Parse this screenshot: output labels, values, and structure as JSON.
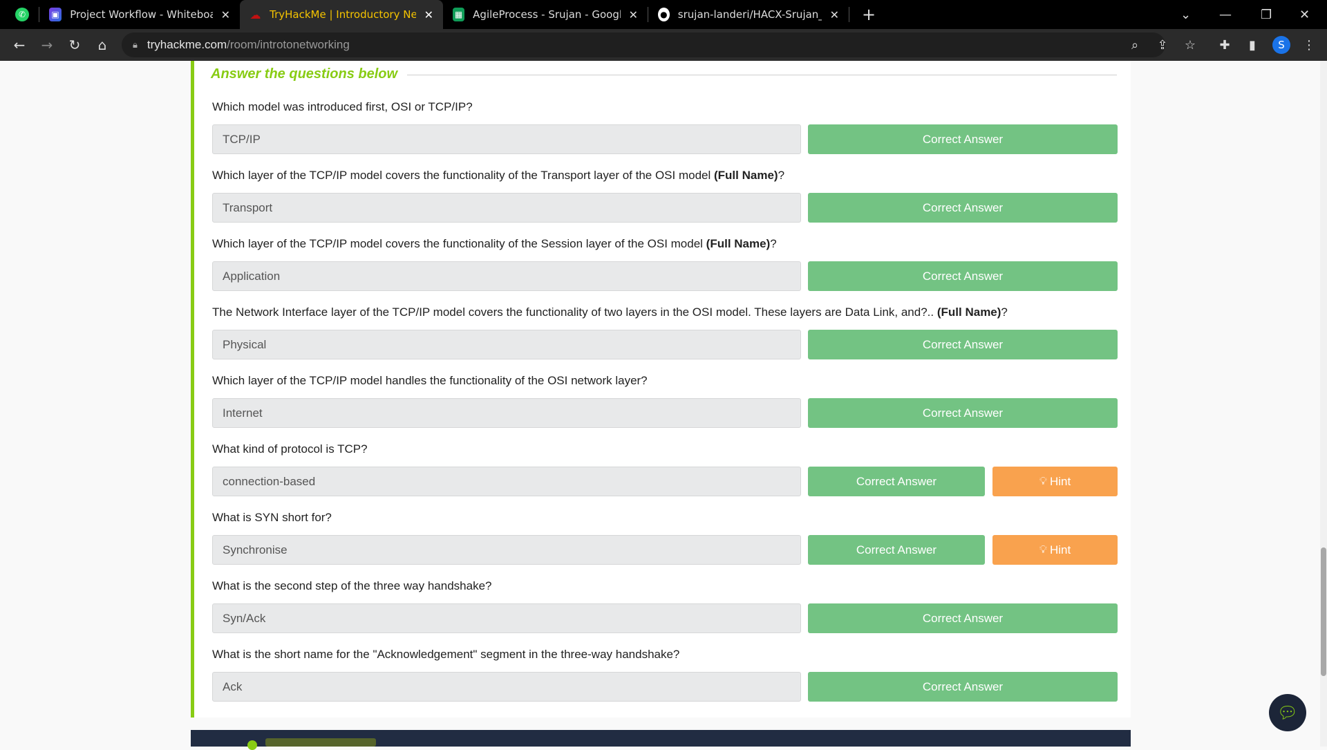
{
  "browser": {
    "tabs": [
      {
        "title": "",
        "icon": "whatsapp-icon",
        "color": "#25d366"
      },
      {
        "title": "Project Workflow - Whiteboard",
        "icon": "whiteboard-icon",
        "color": "#7b3fe4"
      },
      {
        "title": "TryHackMe | Introductory Networ",
        "icon": "tryhackme-icon",
        "color": "#c11111",
        "active": true
      },
      {
        "title": "AgileProcess - Srujan - Google Sh",
        "icon": "google-sheets-icon",
        "color": "#0f9d58"
      },
      {
        "title": "srujan-landeri/HACX-Srujan_Land",
        "icon": "github-icon",
        "color": "#ffffff"
      }
    ],
    "url_host": "tryhackme.com",
    "url_path": "/room/introtonetworking",
    "profile_initial": "S"
  },
  "section": {
    "heading": "Answer the questions below"
  },
  "questions": [
    {
      "text": "Which model was introduced first, OSI or TCP/IP?",
      "bold": "",
      "suffix": "",
      "answer": "TCP/IP",
      "button": "Correct Answer",
      "hint": ""
    },
    {
      "text": "Which layer of the TCP/IP model covers the functionality of the Transport layer of the OSI model ",
      "bold": "(Full Name)",
      "suffix": "?",
      "answer": "Transport",
      "button": "Correct Answer",
      "hint": ""
    },
    {
      "text": "Which layer of the TCP/IP model covers the functionality of the Session layer of the OSI model ",
      "bold": "(Full Name)",
      "suffix": "?",
      "answer": "Application",
      "button": "Correct Answer",
      "hint": ""
    },
    {
      "text": "The Network Interface layer of the TCP/IP model covers the functionality of two layers in the OSI model. These layers are Data Link, and?.. ",
      "bold": "(Full Name)",
      "suffix": "?",
      "answer": "Physical",
      "button": "Correct Answer",
      "hint": ""
    },
    {
      "text": "Which layer of the TCP/IP model handles the functionality of the OSI network layer?",
      "bold": "",
      "suffix": "",
      "answer": "Internet",
      "button": "Correct Answer",
      "hint": ""
    },
    {
      "text": "What kind of protocol is TCP?",
      "bold": "",
      "suffix": "",
      "answer": "connection-based",
      "button": "Correct Answer",
      "hint": "Hint"
    },
    {
      "text": "What is SYN short for?",
      "bold": "",
      "suffix": "",
      "answer": "Synchronise",
      "button": "Correct Answer",
      "hint": "Hint"
    },
    {
      "text": "What is the second step of the three way handshake?",
      "bold": "",
      "suffix": "",
      "answer": "Syn/Ack",
      "button": "Correct Answer",
      "hint": ""
    },
    {
      "text": "What is the short name for the \"Acknowledgement\" segment in the three-way handshake?",
      "bold": "",
      "suffix": "",
      "answer": "Ack",
      "button": "Correct Answer",
      "hint": ""
    }
  ],
  "colors": {
    "accent": "#88cc14",
    "correct": "#73c383",
    "hint": "#f9a24e"
  }
}
